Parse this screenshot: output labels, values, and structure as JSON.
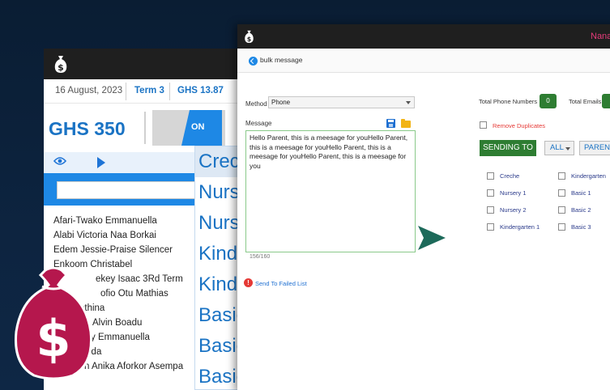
{
  "back_window": {
    "date": "16 August, 2023",
    "term": "Term 3",
    "ghs": "GHS 13.87",
    "amount": "GHS 350",
    "toggle_label": "ON",
    "names": [
      "Afari-Twako Emmanuella",
      "Alabi Victoria Naa Borkai",
      "Edem Jessie-Praise Silencer",
      "Enkoom Christabel",
      "ekey Isaac 3Rd Term",
      "ofio Otu Mathias",
      "ethina",
      "Alvin Boadu",
      "y Emmanuella",
      "ida",
      "n Anika Aforkor Asempa"
    ],
    "class_list": [
      "Crec",
      "Nurs",
      "Nurs",
      "Kind",
      "Kind",
      "Basic",
      "Basic",
      "Basic"
    ]
  },
  "front_window": {
    "user": "Nana",
    "breadcrumb": "bulk message",
    "method_label": "Method",
    "method_value": "Phone",
    "message_label": "Message",
    "message_text": "Hello Parent, this is a meesage for youHello Parent, this is a meesage for youHello Parent, this is a meesage for youHello Parent, this is a meesage for you",
    "char_counter": "156/160",
    "failed_link": "Send To Failed List",
    "total_phone_label": "Total Phone Numbers",
    "total_phone_value": "0",
    "total_emails_label": "Total Emails",
    "remove_duplicates": "Remove Duplicates",
    "sending_to": "SENDING TO",
    "all_select": "ALL",
    "parent_button": "PARENT",
    "classes_left": [
      "Creche",
      "Nursery 1",
      "Nursery 2",
      "Kindergarten 1"
    ],
    "classes_right": [
      "Kindergarten",
      "Basic 1",
      "Basic 2",
      "Basic 3"
    ]
  },
  "icons": {
    "logo": "money-bag-icon",
    "view": "eye-icon",
    "play": "play-icon",
    "save": "save-icon",
    "folder": "folder-icon",
    "error": "exclamation-icon",
    "send": "send-arrow-icon",
    "back": "back-arrow-icon"
  },
  "colors": {
    "accent": "#1e88e5",
    "green": "#2e7d32",
    "brand": "#b5174d",
    "error": "#e53935"
  }
}
